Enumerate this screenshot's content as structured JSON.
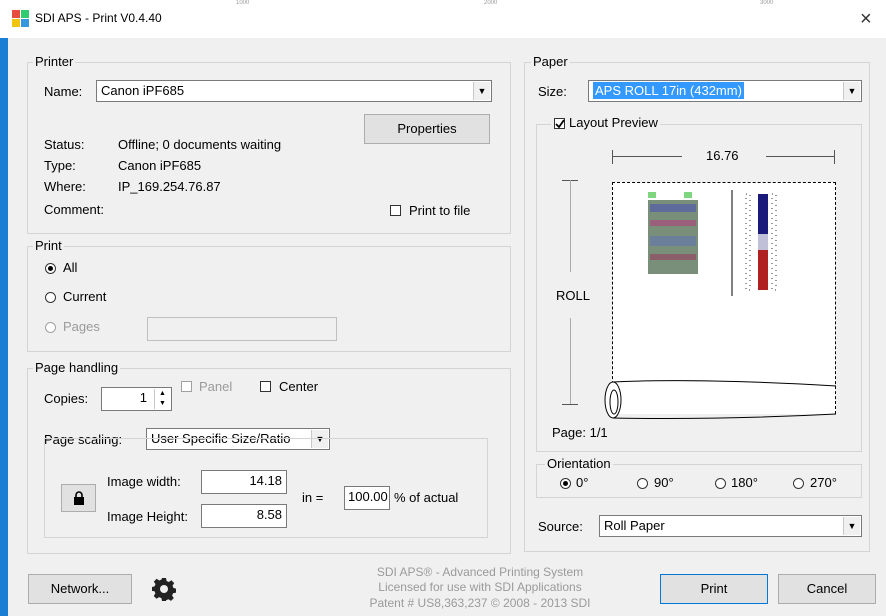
{
  "window": {
    "title": "SDI APS - Print V0.4.40",
    "close_glyph": "×",
    "ruler_ticks": [
      "1000",
      "2000",
      "3000"
    ]
  },
  "printer": {
    "group_label": "Printer",
    "name_label": "Name:",
    "name_value": "Canon iPF685",
    "properties_button": "Properties",
    "status_label": "Status:",
    "status_value": "Offline; 0 documents waiting",
    "type_label": "Type:",
    "type_value": "Canon iPF685",
    "where_label": "Where:",
    "where_value": "IP_169.254.76.87",
    "comment_label": "Comment:",
    "print_to_file_label": "Print to file"
  },
  "print": {
    "group_label": "Print",
    "all_label": "All",
    "current_label": "Current",
    "pages_label": "Pages",
    "pages_value": ""
  },
  "page_handling": {
    "group_label": "Page handling",
    "copies_label": "Copies:",
    "copies_value": "1",
    "panel_label": "Panel",
    "center_label": "Center",
    "page_scaling_label": "Page scaling:",
    "page_scaling_value": "User Specific Size/Ratio",
    "image_width_label": "Image width:",
    "image_width_value": "14.18",
    "image_height_label": "Image Height:",
    "image_height_value": "8.58",
    "unit_label": "in =",
    "percent_value": "100.00",
    "percent_label": "% of actual"
  },
  "paper": {
    "group_label": "Paper",
    "size_label": "Size:",
    "size_value": "APS ROLL 17in (432mm)",
    "layout_preview_label": "Layout Preview",
    "width_value": "16.76",
    "roll_label": "ROLL",
    "page_label": "Page: 1/1",
    "orientation_label": "Orientation",
    "orientations": [
      "0°",
      "90°",
      "180°",
      "270°"
    ],
    "source_label": "Source:",
    "source_value": "Roll Paper"
  },
  "footer": {
    "network_button": "Network...",
    "line1": "SDI APS® - Advanced Printing System",
    "line2": "Licensed for use with SDI Applications",
    "line3": "Patent # US8,363,237 © 2008 - 2013 SDI",
    "print_button": "Print",
    "cancel_button": "Cancel"
  },
  "colors": {
    "accent": "#1a7fd4",
    "selection": "#3399ff"
  }
}
